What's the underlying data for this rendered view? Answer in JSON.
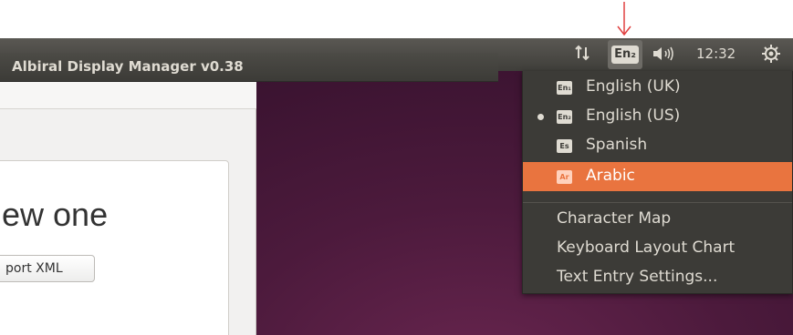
{
  "window": {
    "title": "Albiral Display Manager v0.38",
    "heading": "ew one",
    "import_button_label": "port XML"
  },
  "panel": {
    "keyboard_indicator": "En₂",
    "clock": "12:32",
    "icons": [
      "network-icon",
      "keyboard-indicator",
      "volume-icon",
      "gear-icon"
    ]
  },
  "language_menu": {
    "languages": [
      {
        "badge": "En₁",
        "label": "English (UK)",
        "selected": false,
        "highlighted": false
      },
      {
        "badge": "En₂",
        "label": "English (US)",
        "selected": true,
        "highlighted": false
      },
      {
        "badge": "Es",
        "label": "Spanish",
        "selected": false,
        "highlighted": false
      },
      {
        "badge": "Ar",
        "label": "Arabic",
        "selected": false,
        "highlighted": true
      }
    ],
    "actions": [
      {
        "label": "Character Map"
      },
      {
        "label": "Keyboard Layout Chart"
      },
      {
        "label": "Text Entry Settings..."
      }
    ]
  },
  "colors": {
    "menu_highlight": "#e9743f",
    "panel_background": "#3c3b37",
    "annotation_arrow": "#e04040"
  }
}
